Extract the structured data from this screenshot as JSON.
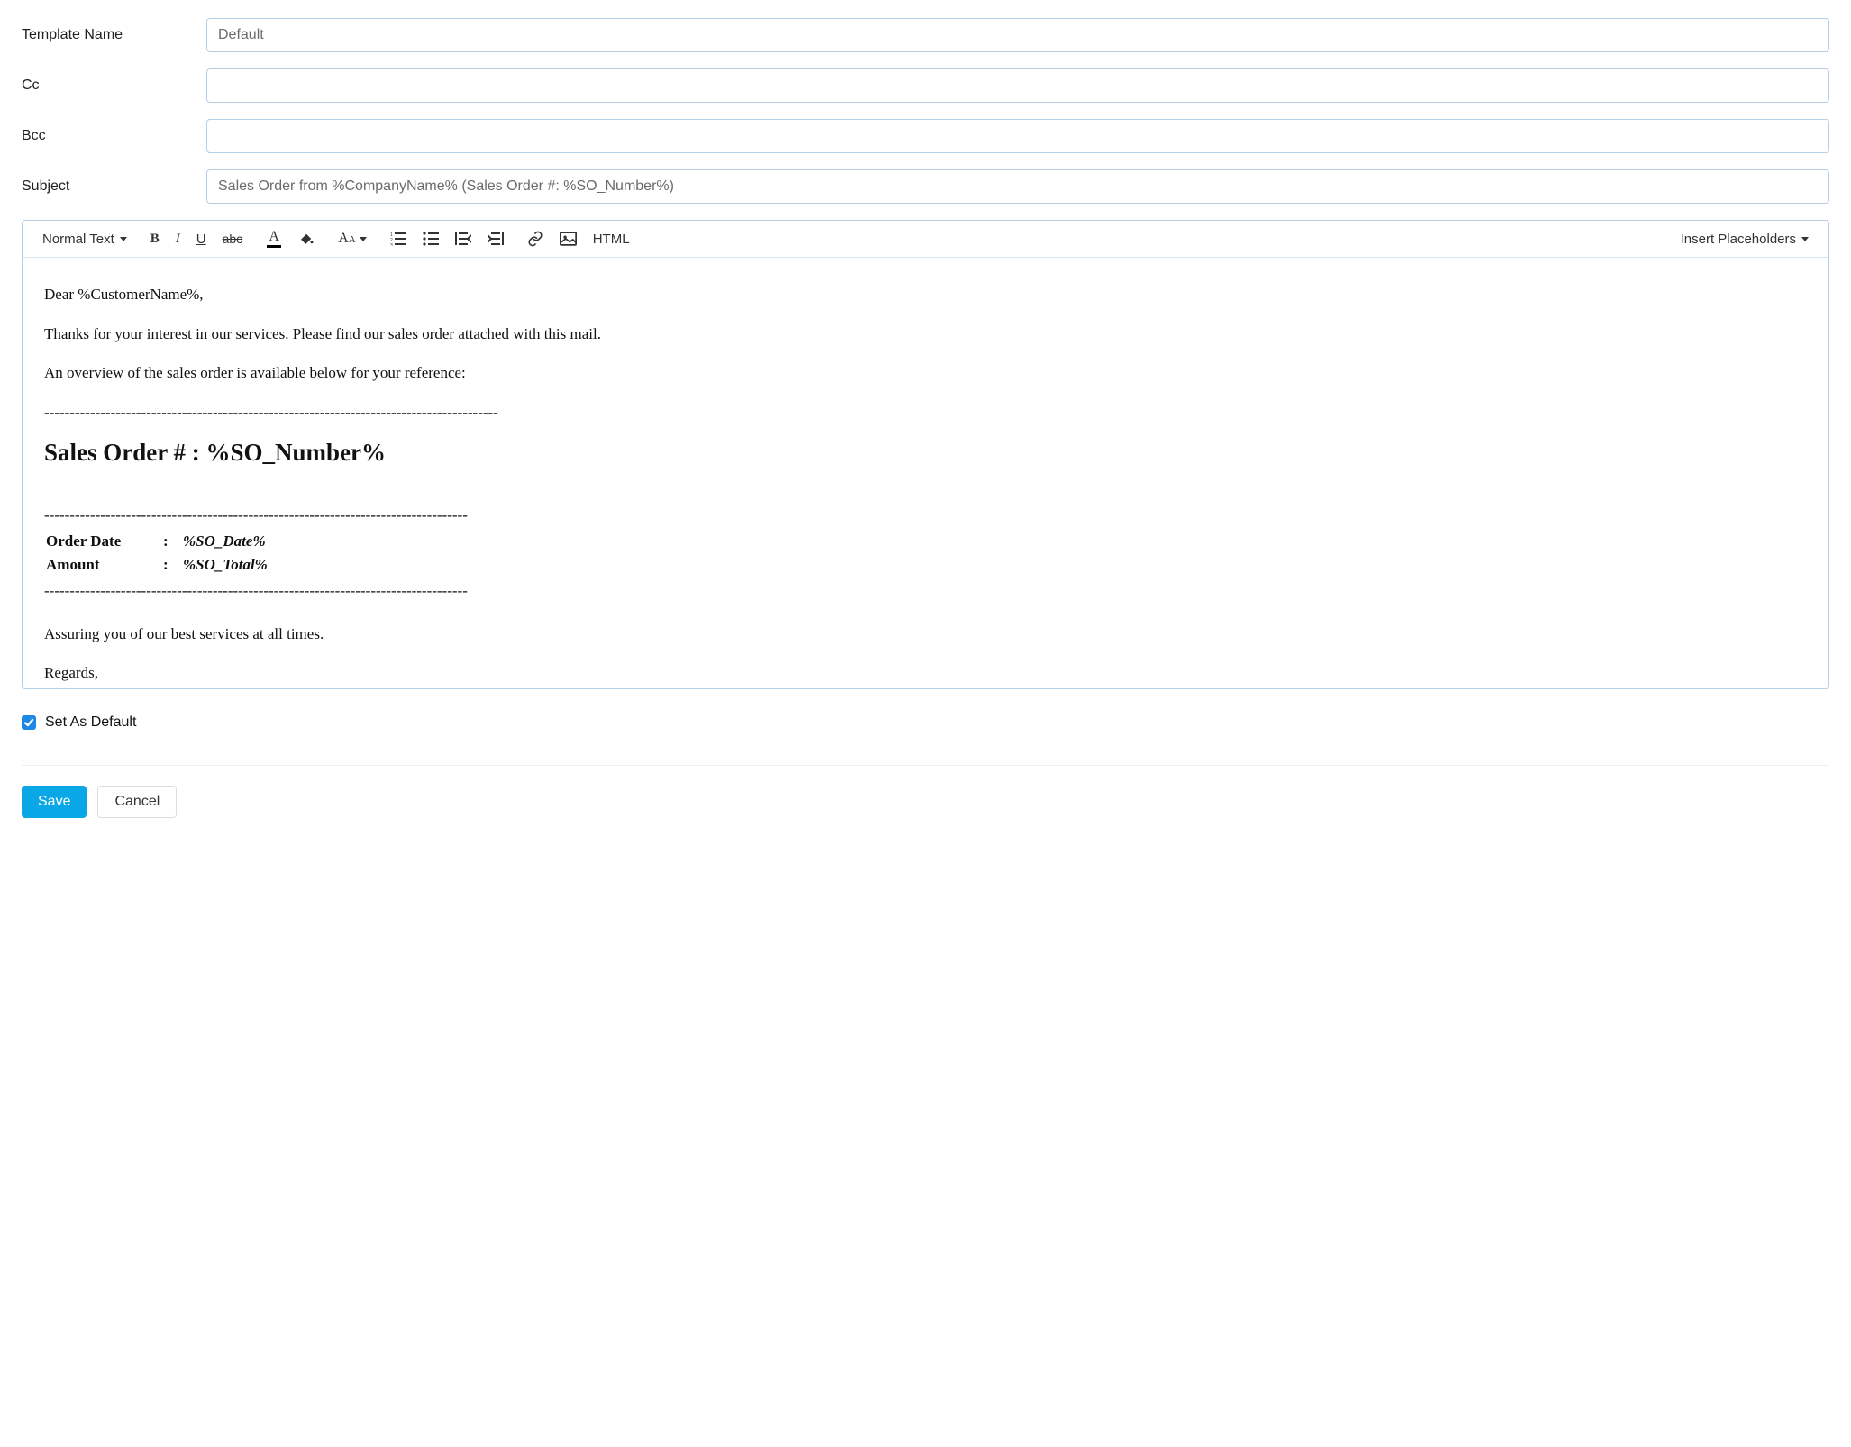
{
  "fields": {
    "templateName": {
      "label": "Template Name",
      "value": "Default"
    },
    "cc": {
      "label": "Cc",
      "value": ""
    },
    "bcc": {
      "label": "Bcc",
      "value": ""
    },
    "subject": {
      "label": "Subject",
      "value": "Sales Order from %CompanyName% (Sales Order #: %SO_Number%)"
    }
  },
  "toolbar": {
    "textStyle": "Normal Text",
    "htmlLabel": "HTML",
    "placeholders": "Insert Placeholders"
  },
  "body": {
    "greeting": "Dear %CustomerName%,",
    "intro1": "Thanks for your interest in our services. Please find our sales order attached with this mail.",
    "intro2": "An overview of the sales order is available below for your reference:",
    "dashLong": "-----------------------------------------------------------------------------------------",
    "heading": "Sales Order # : %SO_Number%",
    "dashNarrow": "-----------------------------------------------------------------------------------",
    "details": {
      "orderDateLabel": "Order Date",
      "orderDateValue": "%SO_Date%",
      "amountLabel": "Amount",
      "amountValue": "%SO_Total%"
    },
    "assurance": "Assuring you of our best services at all times.",
    "regards": "Regards,"
  },
  "setDefault": {
    "label": "Set As Default",
    "checked": true
  },
  "buttons": {
    "save": "Save",
    "cancel": "Cancel"
  }
}
